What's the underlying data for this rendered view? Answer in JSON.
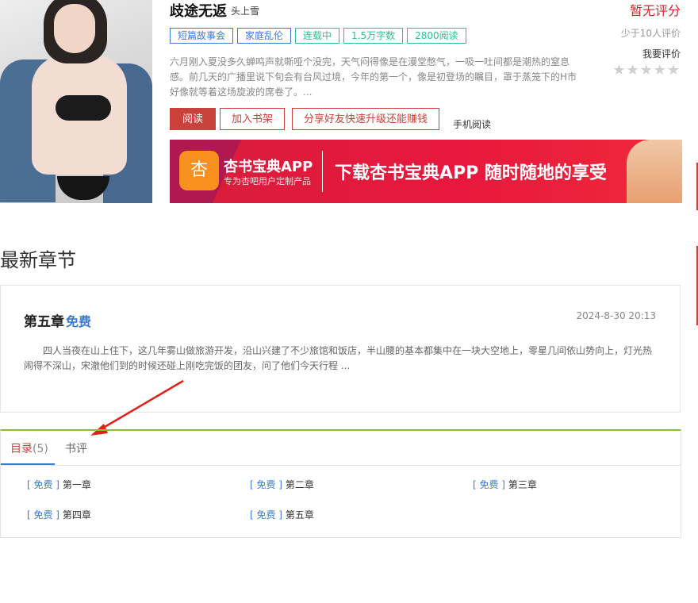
{
  "book": {
    "title": "歧途无返",
    "author": "头上雪",
    "tags": [
      "短篇故事会",
      "家庭乱伦",
      "连载中",
      "1.5万字数",
      "2800阅读"
    ],
    "description": "六月刚入夏没多久蝉鸣声就嘶哑个没完，天气闷得像是在漫堂憋气，一吸一吐间都是潮热的窒息感。前几天的广播里说下旬会有台风过境，今年的第一个，像是初登场的瞩目，罩于蒸笼下的H市好像就等着这场旋波的席卷了。..."
  },
  "rating": {
    "score_text": "暂无评分",
    "count_text": "少于10人评价",
    "rate_label": "我要评价",
    "stars": "★★★★★"
  },
  "buttons": {
    "read": "阅读",
    "add_shelf": "加入书架",
    "share": "分享好友快速升级还能赚钱",
    "mobile": "手机阅读"
  },
  "banner": {
    "icon_text": "杏",
    "app_name": "杏书宝典APP",
    "app_sub": "专为杏吧用户定制产品",
    "slogan": "下载杏书宝典APP 随时随地的享受"
  },
  "latest": {
    "section_title": "最新章节",
    "chapter_title": "第五章",
    "chapter_free": "免费",
    "date": "2024-8-30 20:13",
    "excerpt": "四人当夜在山上住下，这几年雾山做旅游开发，沿山兴建了不少旅馆和饭店，半山腰的基本都集中在一块大空地上，零星几间依山势向上，灯光热闹得不深山，宋澈他们到的时候还碰上刚吃完饭的团友，问了他们今天行程 ..."
  },
  "toc": {
    "tab_catalog": "目录",
    "tab_catalog_count": "(5)",
    "tab_review": "书评",
    "free_label": "[ 免费 ]",
    "chapters": [
      "第一章",
      "第二章",
      "第三章",
      "第四章",
      "第五章"
    ]
  },
  "colors": {
    "accent_red": "#c9413a",
    "link_blue": "#3a7bd5",
    "tag_green": "#2fbf8f",
    "toc_top_border": "#8bbf3a"
  }
}
